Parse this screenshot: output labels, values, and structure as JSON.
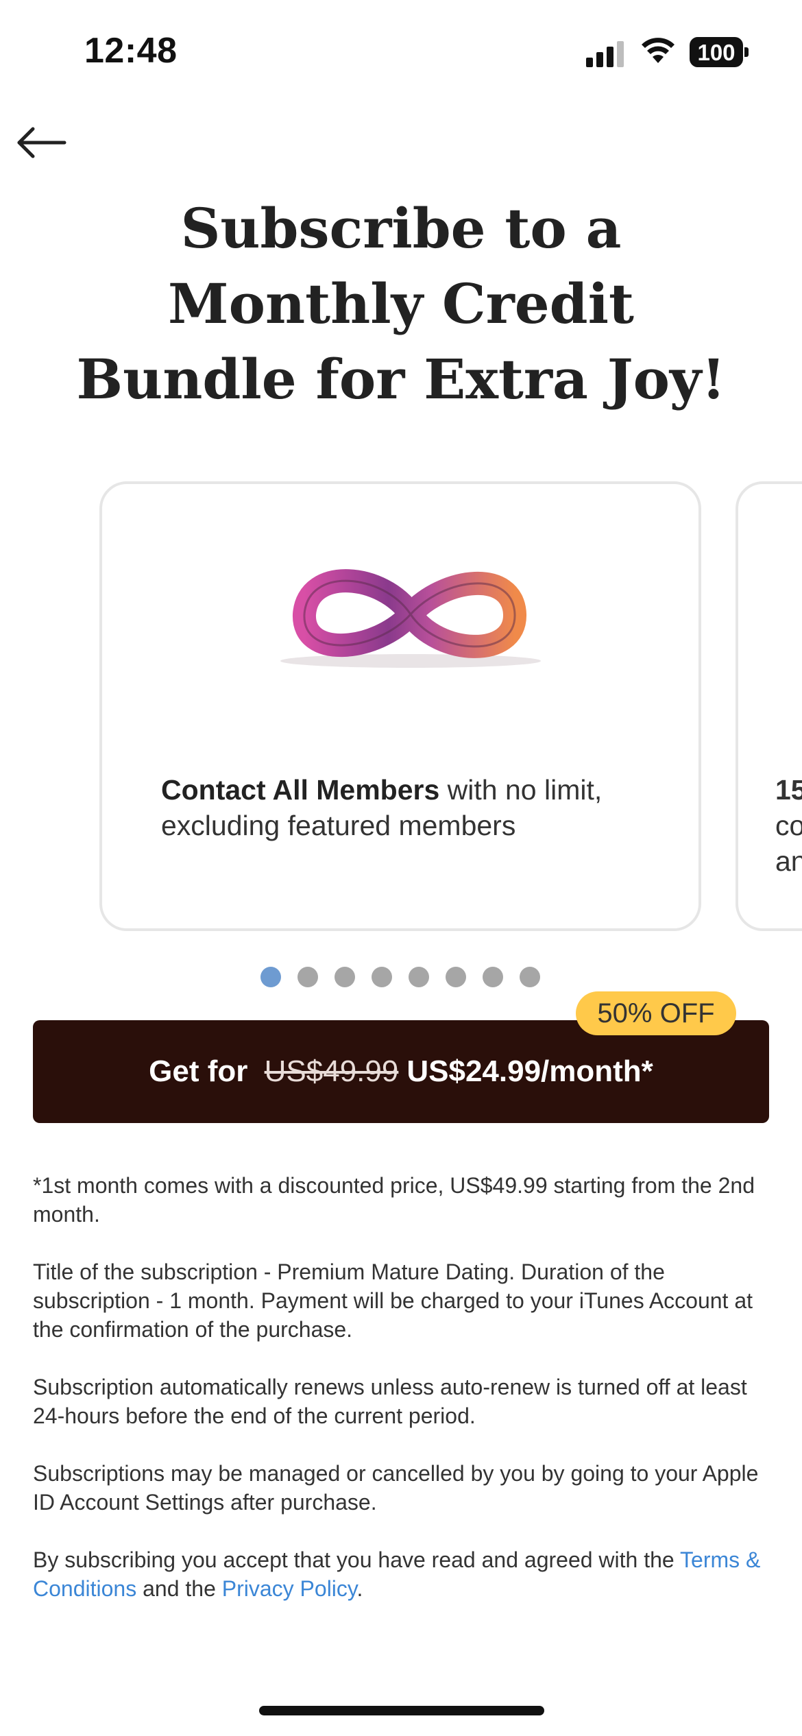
{
  "status_bar": {
    "time": "12:48",
    "battery": "100"
  },
  "header": {
    "title": "Subscribe to a Monthly Credit Bundle for Extra Joy!"
  },
  "carousel": {
    "cards": [
      {
        "bold": "Contact All Members",
        "rest": " with no limit, excluding featured members",
        "image": "infinity-icon"
      },
      {
        "peek_lines": [
          "15",
          "co",
          "an"
        ]
      }
    ],
    "page_count": 8,
    "active_index": 0
  },
  "offer": {
    "badge": "50% OFF",
    "prefix": "Get for",
    "old_price": "US$49.99",
    "new_price": "US$24.99/month*"
  },
  "legal": {
    "p1": "*1st month comes with a discounted price, US$49.99 starting from the 2nd month.",
    "p2": "Title of the subscription - Premium Mature Dating. Duration of the subscription - 1 month. Payment will be charged to your iTunes Account at the confirmation of the purchase.",
    "p3": "Subscription automatically renews unless auto-renew is turned off at least 24-hours before the end of the current period.",
    "p4": "Subscriptions may be managed or cancelled by you by going to your Apple ID Account Settings after purchase.",
    "p5_prefix": "By subscribing you accept that you have read and agreed with the ",
    "terms_link": "Terms & Conditions",
    "p5_middle": " and the ",
    "privacy_link": "Privacy Policy",
    "p5_suffix": "."
  },
  "colors": {
    "cta_bg": "#2a0f0a",
    "badge_bg": "#ffc94a",
    "link": "#3b86d6",
    "dot_active": "#6e9bd1"
  }
}
